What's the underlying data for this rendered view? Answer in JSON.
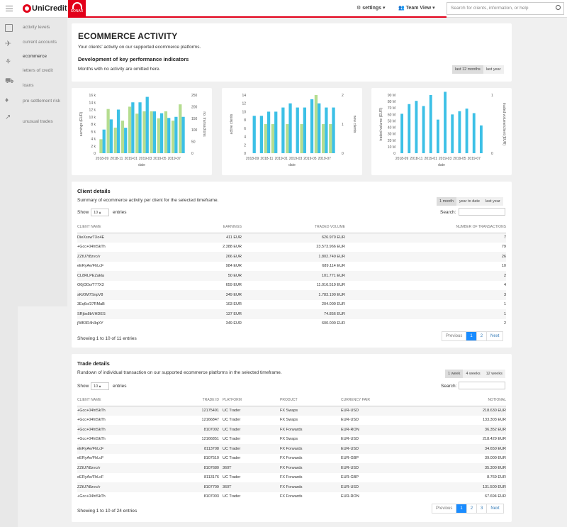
{
  "header": {
    "brand": "UniCredit",
    "sonar": "SONAR",
    "settings": "settings",
    "team_view": "Team View",
    "search_placeholder": "Search for clients, information, or help"
  },
  "sidebar": {
    "items": [
      {
        "label": "activity levels"
      },
      {
        "label": "current accounts"
      },
      {
        "label": "ecommerce"
      },
      {
        "label": "letters of credit"
      },
      {
        "label": "loans"
      },
      {
        "label": "pre settlement risk"
      },
      {
        "label": "unusual trades"
      }
    ]
  },
  "activity": {
    "title": "ECOMMERCE ACTIVITY",
    "subtitle": "Your clients' activity on our supported ecommerce platforms.",
    "kpi_title": "Development of key performance indicators",
    "note": "Months with no activity are omitted here.",
    "ranges": [
      "last 12 months",
      "last year"
    ]
  },
  "charts": {
    "months": [
      "2018-09",
      "2018-10",
      "2018-11",
      "2018-12",
      "2019-01",
      "2019-02",
      "2019-03",
      "2019-04",
      "2019-05",
      "2019-06",
      "2019-07",
      "2019-08"
    ],
    "tick_labels": [
      "2018-09",
      "2018-11",
      "2019-01",
      "2019-03",
      "2019-05",
      "2019-07"
    ],
    "xlabel": "date",
    "c1": {
      "ylabel": "earnings (EUR)",
      "y2label": "no. transactions",
      "yticks": [
        "0",
        "2 k",
        "4 k",
        "6 k",
        "8 k",
        "10 k",
        "12 k",
        "14 k",
        "16 k"
      ],
      "y2ticks": [
        "0",
        "50",
        "100",
        "150",
        "200",
        "250"
      ]
    },
    "c2": {
      "ylabel": "active clients",
      "y2label": "new clients",
      "yticks": [
        "0",
        "2",
        "4",
        "6",
        "8",
        "10",
        "12",
        "14"
      ],
      "y2ticks": [
        "0",
        "1",
        "2"
      ]
    },
    "c3": {
      "ylabel": "traded volume (EUR)",
      "y2label": "traded volume/client (EUR)",
      "yticks": [
        "0",
        "10 M",
        "20 M",
        "30 M",
        "40 M",
        "50 M",
        "60 M",
        "70 M",
        "80 M",
        "90 M"
      ],
      "y2ticks": [
        "0",
        "1"
      ]
    }
  },
  "chart_data": [
    {
      "type": "bar",
      "x": [
        "2018-09",
        "2018-10",
        "2018-11",
        "2018-12",
        "2019-01",
        "2019-02",
        "2019-03",
        "2019-04",
        "2019-05",
        "2019-06",
        "2019-07",
        "2019-08"
      ],
      "series": [
        {
          "name": "earnings (EUR)",
          "values": [
            6500,
            9300,
            12000,
            7000,
            14000,
            14000,
            15500,
            11500,
            11000,
            9700,
            10000,
            10000
          ]
        },
        {
          "name": "no. transactions",
          "values": [
            60,
            190,
            110,
            140,
            200,
            170,
            180,
            180,
            150,
            180,
            140,
            210
          ]
        }
      ],
      "ylim": [
        0,
        16000
      ],
      "y2lim": [
        0,
        250
      ],
      "colors": [
        "#3cc0e6",
        "#b5dd90"
      ]
    },
    {
      "type": "bar",
      "x": [
        "2018-09",
        "2018-10",
        "2018-11",
        "2018-12",
        "2019-01",
        "2019-02",
        "2019-03",
        "2019-04",
        "2019-05",
        "2019-06",
        "2019-07",
        "2019-08"
      ],
      "series": [
        {
          "name": "active clients",
          "values": [
            9,
            9,
            10,
            10,
            11,
            12,
            11,
            11,
            13,
            12,
            11,
            11
          ]
        },
        {
          "name": "new clients",
          "values": [
            0,
            0,
            1,
            1,
            0,
            1,
            0,
            1,
            0,
            2,
            1,
            1
          ]
        }
      ],
      "ylim": [
        0,
        14
      ],
      "y2lim": [
        0,
        2
      ]
    },
    {
      "type": "bar",
      "x": [
        "2018-09",
        "2018-10",
        "2018-11",
        "2018-12",
        "2019-01",
        "2019-02",
        "2019-03",
        "2019-04",
        "2019-05",
        "2019-06",
        "2019-07",
        "2019-08"
      ],
      "series": [
        {
          "name": "traded volume (EUR)",
          "values": [
            61000000,
            76000000,
            81000000,
            73000000,
            90000000,
            52000000,
            95000000,
            60000000,
            65000000,
            69000000,
            62000000,
            43000000
          ]
        }
      ],
      "ylim": [
        0,
        90000000
      ]
    }
  ],
  "client": {
    "title": "Client details",
    "subtitle": "Summary of ecommerce activity per client for the selected timeframe.",
    "ranges": [
      "1 month",
      "year to date",
      "last year"
    ],
    "show": "Show",
    "entries_count": "10",
    "entries": "entries",
    "search": "Search:",
    "columns": [
      "CLIENT NAME",
      "EARNINGS",
      "TRADED VOLUME",
      "NUMBER OF TRANSACTIONS"
    ],
    "rows": [
      [
        "DieXsswTXo4E",
        "411 EUR",
        "626.970 EUR",
        "7"
      ],
      [
        "+Gcc+04htSkTh",
        "2.388 EUR",
        "23.573.966 EUR",
        "79"
      ],
      [
        "ZZtU7t8zvc/v",
        "266 EUR",
        "1.802.740 EUR",
        "26"
      ],
      [
        "eERyAe/FhLcF",
        "984 EUR",
        "689.114 EUR",
        "10"
      ],
      [
        "CL8RLPEZakla",
        "50 EUR",
        "101.771 EUR",
        "2"
      ],
      [
        "O0jODo/T77X3",
        "659 EUR",
        "11.016.519 EUR",
        "4"
      ],
      [
        "sKi/0M7SnpV8",
        "349 EUR",
        "1.783.190 EUR",
        "3"
      ],
      [
        "3Eq6o/37RMaB",
        "103 EUR",
        "204.000 EUR",
        "1"
      ],
      [
        "SRjbs8bVHDES",
        "137 EUR",
        "74.856 EUR",
        "1"
      ],
      [
        "jWB3R4h3qXY",
        "349 EUR",
        "600.000 EUR",
        "2"
      ]
    ],
    "info": "Showing 1 to 10 of 11 entries",
    "pages": [
      "Previous",
      "1",
      "2",
      "Next"
    ]
  },
  "trade": {
    "title": "Trade details",
    "subtitle": "Rundown of individual transaction on our supported ecommerce platforms in the selected timeframe.",
    "ranges": [
      "1 week",
      "4 weeks",
      "12 weeks"
    ],
    "show": "Show",
    "entries_count": "10",
    "entries": "entries",
    "search": "Search:",
    "columns": [
      "CLIENT NAME",
      "TRADE ID",
      "PLATFORM",
      "PRODUCT",
      "CURRENCY PAIR",
      "NOTIONAL"
    ],
    "rows": [
      [
        "+Gcc+04htSkTh",
        "12175491",
        "UC Trader",
        "FX Swaps",
        "EUR-USD",
        "218.630 EUR"
      ],
      [
        "+Gcc+04htSkTh",
        "12166847",
        "UC Trader",
        "FX Swaps",
        "EUR-USD",
        "133.303 EUR"
      ],
      [
        "+Gcc+04htSkTh",
        "8107002",
        "UC Trader",
        "FX Forwards",
        "EUR-RON",
        "36.352 EUR"
      ],
      [
        "+Gcc+04htSkTh",
        "12166851",
        "UC Trader",
        "FX Swaps",
        "EUR-USD",
        "218.429 EUR"
      ],
      [
        "eERyAe/FhLcF",
        "8113708",
        "UC Trader",
        "FX Forwards",
        "EUR-USD",
        "34.650 EUR"
      ],
      [
        "eERyAe/FhLcF",
        "8107510",
        "UC Trader",
        "FX Forwards",
        "EUR-GBP",
        "39.000 EUR"
      ],
      [
        "ZZtU7t8zvc/v",
        "8107680",
        "360T",
        "FX Forwards",
        "EUR-USD",
        "35.300 EUR"
      ],
      [
        "eERyAe/FhLcF",
        "8113176",
        "UC Trader",
        "FX Forwards",
        "EUR-GBP",
        "8.769 EUR"
      ],
      [
        "ZZtU7t8zvc/v",
        "8107709",
        "360T",
        "FX Forwards",
        "EUR-USD",
        "131.500 EUR"
      ],
      [
        "+Gcc+04htSkTh",
        "8107003",
        "UC Trader",
        "FX Forwards",
        "EUR-RON",
        "67.694 EUR"
      ]
    ],
    "info": "Showing 1 to 10 of 24 entries",
    "pages": [
      "Previous",
      "1",
      "2",
      "3",
      "Next"
    ]
  }
}
